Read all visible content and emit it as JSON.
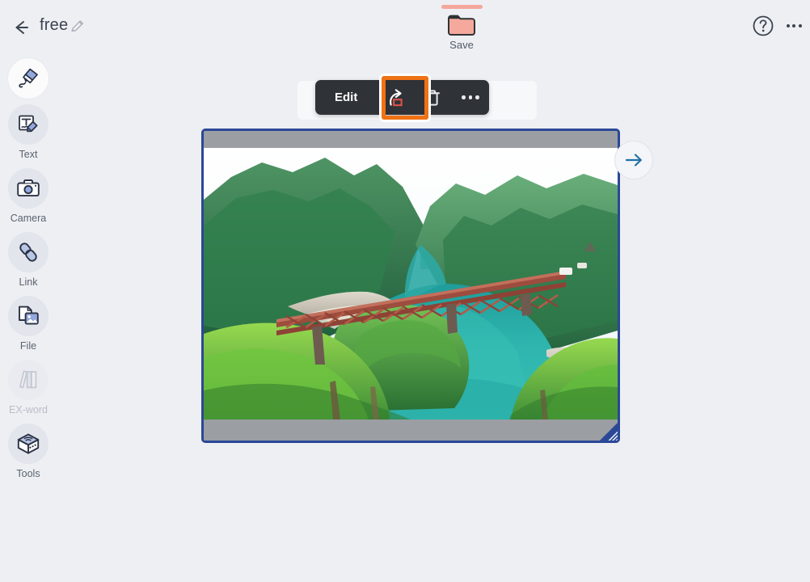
{
  "app": {
    "background_color": "#edeff3",
    "accent_color": "#2b4896",
    "highlight_color": "#ef7215",
    "save_tab_color": "#f5a79b"
  },
  "header": {
    "back_icon": "back-arrow-icon",
    "title": "free",
    "title_edit_icon": "pencil-icon",
    "save": {
      "label": "Save",
      "icon": "folder-icon"
    },
    "help_icon": "help-circle-icon",
    "overflow_icon": "more-horizontal-icon"
  },
  "sidebar": {
    "items": [
      {
        "label": "",
        "icon": "pen-icon",
        "name": "pen",
        "active": true,
        "disabled": false
      },
      {
        "label": "Text",
        "icon": "text-edit-icon",
        "name": "text",
        "active": false,
        "disabled": false
      },
      {
        "label": "Camera",
        "icon": "camera-icon",
        "name": "camera",
        "active": false,
        "disabled": false
      },
      {
        "label": "Link",
        "icon": "link-chain-icon",
        "name": "link",
        "active": false,
        "disabled": false
      },
      {
        "label": "File",
        "icon": "file-image-icon",
        "name": "file",
        "active": false,
        "disabled": false
      },
      {
        "label": "EX-word",
        "icon": "books-icon",
        "name": "ex-word",
        "active": false,
        "disabled": true
      },
      {
        "label": "Tools",
        "icon": "toolbox-icon",
        "name": "tools",
        "active": false,
        "disabled": false
      }
    ]
  },
  "context_toolbar": {
    "edit_label": "Edit",
    "share_icon": "share-export-icon",
    "delete_icon": "trash-icon",
    "more_icon": "more-horizontal-icon",
    "highlighted_item": "share-export-icon"
  },
  "canvas": {
    "selected_object": {
      "type": "image",
      "alt": "Aerial view of a red steel truss railway bridge crossing a turquoise river between green forested mountains",
      "selected": true,
      "border_color": "#2b4896",
      "letterbox_color": "#9b9ea3",
      "resize_handle": "resize-handle-bottom-right"
    },
    "next_page_icon": "arrow-right-icon"
  }
}
